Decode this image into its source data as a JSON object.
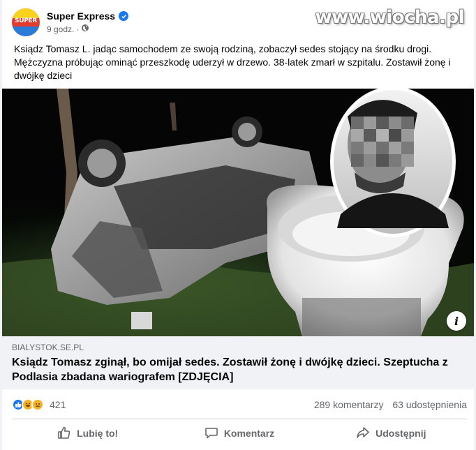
{
  "watermark": "www.wiocha.pl",
  "post": {
    "page_name": "Super Express",
    "avatar_text": "SUPER",
    "time": "9 godz.",
    "separator": "·",
    "text": "Ksiądz Tomasz L. jadąc samochodem ze swoją rodziną, zobaczył sedes stojący na środku drogi. Mężczyzna próbując ominąć przeszkodę uderzył w drzewo. 38-latek zmarł w szpitalu. Zostawił żonę i dwójkę dzieci"
  },
  "link_preview": {
    "domain": "BIALYSTOK.SE.PL",
    "title": "Ksiądz Tomasz zginął, bo omijał sedes. Zostawił żonę i dwójkę dzieci. Szeptucha z Podlasia zbadana wariografem [ZDJĘCIA]",
    "info_icon_text": "i"
  },
  "stats": {
    "reaction_count": "421",
    "comments": "289 komentarzy",
    "shares": "63 udostępnienia"
  },
  "actions": {
    "like": "Lubię to!",
    "comment": "Komentarz",
    "share": "Udostępnij"
  },
  "icons": [
    "verified-badge-icon",
    "globe-icon",
    "info-icon",
    "like-reaction-icon",
    "haha-reaction-icon",
    "sad-reaction-icon",
    "thumbs-up-icon",
    "comment-icon",
    "share-icon"
  ],
  "colors": {
    "accent": "#1877f2",
    "muted": "#65676b",
    "link_bg": "#f0f2f5"
  }
}
